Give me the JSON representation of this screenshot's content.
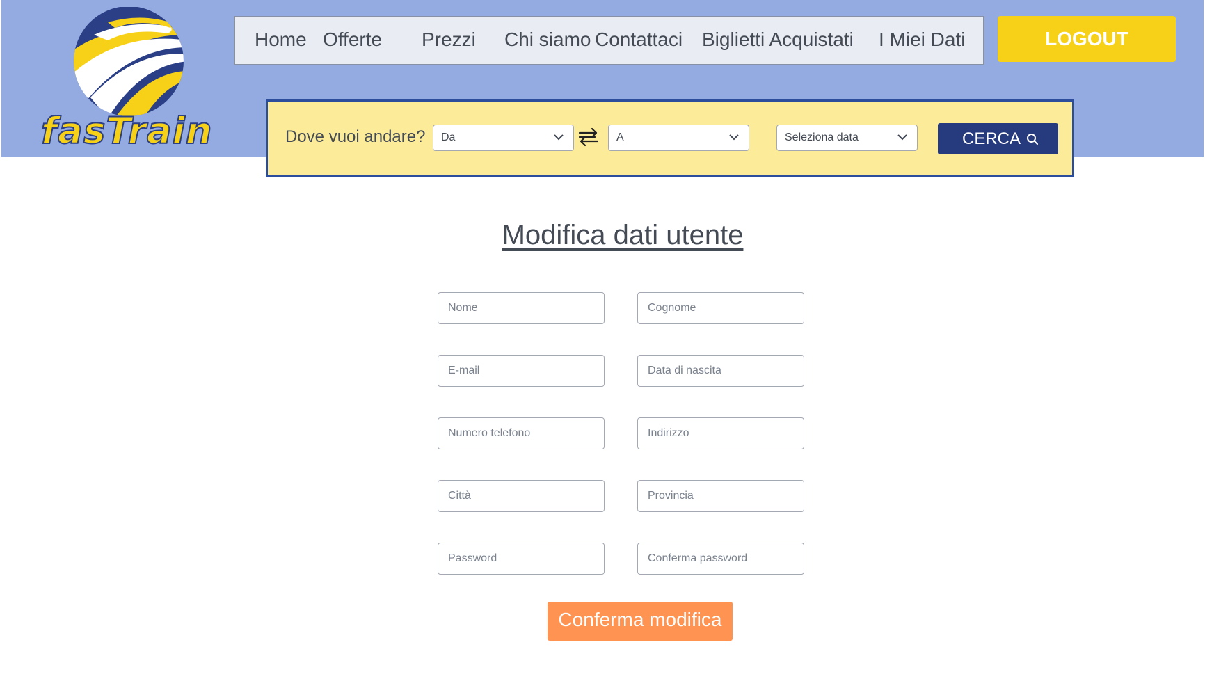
{
  "brand": {
    "name": "fasTrain"
  },
  "nav": {
    "items": [
      {
        "label": "Home"
      },
      {
        "label": "Offerte"
      },
      {
        "label": "Prezzi"
      },
      {
        "label": "Chi siamo"
      },
      {
        "label": "Contattaci"
      },
      {
        "label": "Biglietti Acquistati"
      },
      {
        "label": "I Miei Dati"
      }
    ],
    "logout_label": "LOGOUT"
  },
  "search": {
    "label": "Dove vuoi andare?",
    "from_value": "Da",
    "to_value": "A",
    "date_value": "Seleziona data",
    "button_label": "CERCA",
    "swap_icon": "swap-arrows-icon",
    "search_icon": "search-icon"
  },
  "form": {
    "title": "Modifica dati utente",
    "fields": {
      "nome": "Nome",
      "cognome": "Cognome",
      "email": "E-mail",
      "data_nascita": "Data di nascita",
      "telefono": "Numero telefono",
      "indirizzo": "Indirizzo",
      "citta": "Città",
      "provincia": "Provincia",
      "password": "Password",
      "conferma_password": "Conferma password"
    },
    "submit_label": "Conferma modifica"
  },
  "colors": {
    "header_bg": "#94abe1",
    "search_bg": "#fcec9a",
    "accent_yellow": "#f6d118",
    "navy": "#263b7e",
    "confirm_orange": "#ff9452"
  }
}
